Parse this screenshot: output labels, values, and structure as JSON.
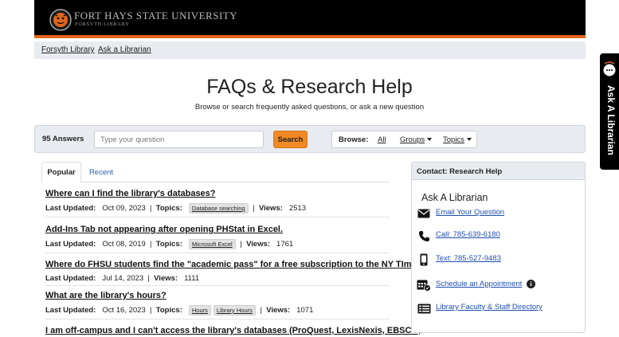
{
  "header": {
    "university": "Fort Hays State University",
    "library": "Forsyth Library"
  },
  "breadcrumb": [
    "Forsyth Library",
    "Ask a Librarian"
  ],
  "page": {
    "title": "FAQs & Research Help",
    "subtitle": "Browse or search frequently asked questions, or ask a new question"
  },
  "search": {
    "answers": "95 Answers",
    "placeholder": "Type your question",
    "button": "Search",
    "browse_label": "Browse:",
    "all": "All",
    "groups": "Groups",
    "topics": "Topics"
  },
  "tabs": [
    "Popular",
    "Recent"
  ],
  "questions": [
    {
      "title": "Where can I find the library's databases?",
      "updated_label": "Last Updated:",
      "date": "Oct 09, 2023",
      "topics_label": "Topics:",
      "topics": [
        "Database searching"
      ],
      "views_label": "Views:",
      "views": "2513"
    },
    {
      "title": "Add-Ins Tab not appearing after opening PHStat in Excel.",
      "updated_label": "Last Updated:",
      "date": "Oct 08, 2019",
      "topics_label": "Topics:",
      "topics": [
        "Microsoft Excel"
      ],
      "views_label": "Views:",
      "views": "1761"
    },
    {
      "title": "Where do FHSU students find the \"academic pass\" for a free subscription to the NY TImes?",
      "updated_label": "Last Updated:",
      "date": "Jul 14, 2023",
      "views_label": "Views:",
      "views": "1111"
    },
    {
      "title": "What are the library's hours?",
      "updated_label": "Last Updated:",
      "date": "Oct 16, 2023",
      "topics_label": "Topics:",
      "topics": [
        "Hours",
        "Library Hours"
      ],
      "views_label": "Views:",
      "views": "1071"
    },
    {
      "title": "I am off-campus and I can't access the library's databases (ProQuest, LexisNexis, EBSCO,"
    }
  ],
  "contact": {
    "header": "Contact: Research Help",
    "title": "Ask A Librarian",
    "items": [
      {
        "icon": "envelope-icon",
        "label": "Email Your Question"
      },
      {
        "icon": "phone-icon",
        "label": "Call: 785-639-6180"
      },
      {
        "icon": "mobile-icon",
        "label": "Text: 785-527-9483"
      },
      {
        "icon": "calendar-icon",
        "label": "Schedule an Appointment"
      },
      {
        "icon": "directory-icon",
        "label": "Library Faculty & Staff Directory"
      }
    ]
  },
  "side_tab": {
    "label": "Ask A Librarian"
  },
  "colors": {
    "accent": "#e1661b",
    "search_button": "#f08a24",
    "link": "#1f4fb0",
    "panel": "#e8ebf0"
  }
}
